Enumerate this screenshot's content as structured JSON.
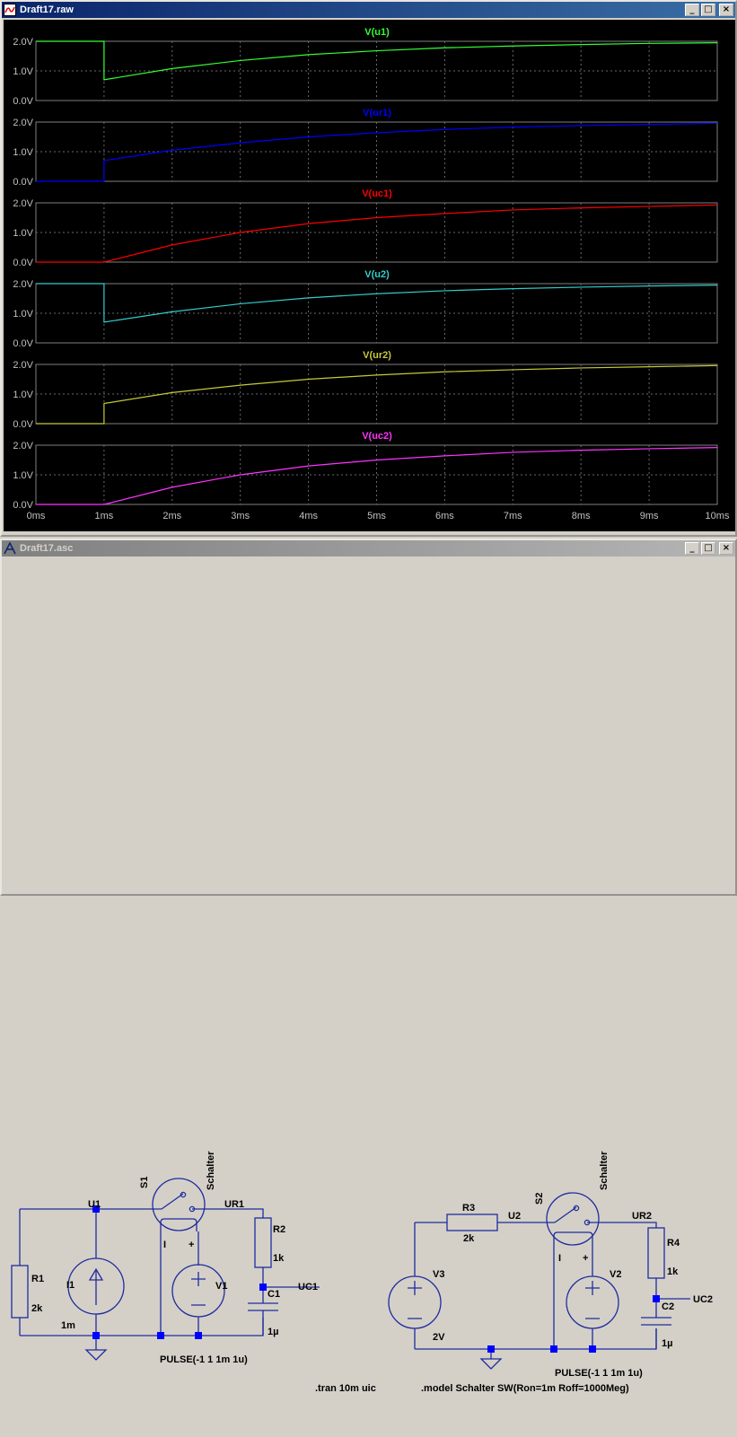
{
  "raw_window": {
    "title": "Draft17.raw",
    "buttons": {
      "minimize": "_",
      "maximize": "□",
      "close": "×"
    }
  },
  "asc_window": {
    "title": "Draft17.asc",
    "buttons": {
      "minimize": "_",
      "maximize": "□",
      "close": "×"
    }
  },
  "chart_data": [
    {
      "type": "line",
      "title": "V(u1)",
      "color": "#33ff33",
      "x_unit": "ms",
      "xlim": [
        0,
        10
      ],
      "ylim": [
        0,
        2
      ],
      "yticks": [
        "2.0V",
        "1.0V",
        "0.0V"
      ],
      "grid": true,
      "x": [
        0,
        1,
        1,
        2,
        3,
        4,
        5,
        6,
        7,
        8,
        9,
        10
      ],
      "y": [
        2,
        2,
        0.7,
        1.08,
        1.35,
        1.55,
        1.68,
        1.78,
        1.84,
        1.89,
        1.93,
        1.95
      ]
    },
    {
      "type": "line",
      "title": "V(ur1)",
      "color": "#0000ff",
      "x_unit": "ms",
      "xlim": [
        0,
        10
      ],
      "ylim": [
        0,
        2
      ],
      "yticks": [
        "2.0V",
        "1.0V",
        "0.0V"
      ],
      "grid": true,
      "x": [
        0,
        1,
        1,
        2,
        3,
        4,
        5,
        6,
        7,
        8,
        9,
        10
      ],
      "y": [
        0,
        0,
        0.7,
        1.05,
        1.3,
        1.5,
        1.64,
        1.75,
        1.83,
        1.88,
        1.92,
        1.96
      ]
    },
    {
      "type": "line",
      "title": "V(uc1)",
      "color": "#ff0000",
      "x_unit": "ms",
      "xlim": [
        0,
        10
      ],
      "ylim": [
        0,
        2
      ],
      "yticks": [
        "2.0V",
        "1.0V",
        "0.0V"
      ],
      "grid": true,
      "x": [
        0,
        1,
        2,
        3,
        4,
        5,
        6,
        7,
        8,
        9,
        10
      ],
      "y": [
        0,
        0,
        0.58,
        1.0,
        1.3,
        1.5,
        1.64,
        1.76,
        1.83,
        1.88,
        1.93
      ]
    },
    {
      "type": "line",
      "title": "V(u2)",
      "color": "#33cccc",
      "x_unit": "ms",
      "xlim": [
        0,
        10
      ],
      "ylim": [
        0,
        2
      ],
      "yticks": [
        "2.0V",
        "1.0V",
        "0.0V"
      ],
      "grid": true,
      "x": [
        0,
        1,
        1,
        2,
        3,
        4,
        5,
        6,
        7,
        8,
        9,
        10
      ],
      "y": [
        2,
        2,
        0.7,
        1.05,
        1.32,
        1.52,
        1.66,
        1.76,
        1.83,
        1.88,
        1.92,
        1.95
      ]
    },
    {
      "type": "line",
      "title": "V(ur2)",
      "color": "#c8c83a",
      "x_unit": "ms",
      "xlim": [
        0,
        10
      ],
      "ylim": [
        0,
        2
      ],
      "yticks": [
        "2.0V",
        "1.0V",
        "0.0V"
      ],
      "grid": true,
      "x": [
        0,
        1,
        1,
        2,
        3,
        4,
        5,
        6,
        7,
        8,
        9,
        10
      ],
      "y": [
        0,
        0,
        0.68,
        1.05,
        1.3,
        1.5,
        1.64,
        1.75,
        1.82,
        1.88,
        1.92,
        1.96
      ]
    },
    {
      "type": "line",
      "title": "V(uc2)",
      "color": "#ff33ff",
      "x_unit": "ms",
      "xlim": [
        0,
        10
      ],
      "ylim": [
        0,
        2
      ],
      "yticks": [
        "2.0V",
        "1.0V",
        "0.0V"
      ],
      "grid": true,
      "x": [
        0,
        1,
        2,
        3,
        4,
        5,
        6,
        7,
        8,
        9,
        10
      ],
      "y": [
        0,
        0,
        0.58,
        1.0,
        1.3,
        1.5,
        1.64,
        1.76,
        1.83,
        1.88,
        1.92
      ],
      "xticks": [
        "0ms",
        "1ms",
        "2ms",
        "3ms",
        "4ms",
        "5ms",
        "6ms",
        "7ms",
        "8ms",
        "9ms",
        "10ms"
      ]
    }
  ],
  "schematic": {
    "wire_color": "#1e2c9e",
    "node_color": "#0000ff",
    "labels": {
      "s1": "S1",
      "schalter1": "Schalter",
      "u1": "U1",
      "ur1": "UR1",
      "r2": "R2",
      "r2v": "1k",
      "i1": "I1",
      "v1": "V1",
      "r1": "R1",
      "r1v": "2k",
      "i1v": "1m",
      "c1": "C1",
      "c1v": "1µ",
      "uc1": "UC1",
      "pulse1": "PULSE(-1 1 1m 1u)",
      "minus1": "I",
      "plus1": "+",
      "s2": "S2",
      "schalter2": "Schalter",
      "r3": "R3",
      "r3v": "2k",
      "u2": "U2",
      "ur2": "UR2",
      "r4": "R4",
      "r4v": "1k",
      "v3": "V3",
      "v3v": "2V",
      "v2": "V2",
      "c2": "C2",
      "c2v": "1µ",
      "uc2": "UC2",
      "pulse2": "PULSE(-1 1 1m 1u)",
      "minus2": "I",
      "plus2": "+",
      "tran": ".tran 10m uic",
      "model": ".model Schalter SW(Ron=1m Roff=1000Meg)"
    }
  }
}
